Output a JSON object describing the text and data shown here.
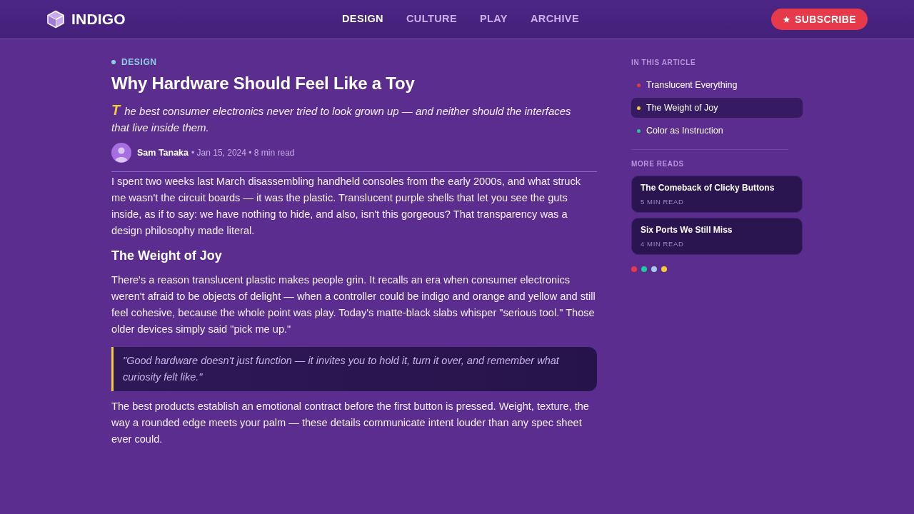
{
  "header": {
    "logo": "INDIGO",
    "nav": [
      {
        "label": "DESIGN",
        "selected": true
      },
      {
        "label": "CULTURE",
        "selected": false
      },
      {
        "label": "PLAY",
        "selected": false
      },
      {
        "label": "ARCHIVE",
        "selected": false
      }
    ],
    "subscribe": "SUBSCRIBE"
  },
  "article": {
    "category": "DESIGN",
    "title": "Why Hardware Should Feel Like a Toy",
    "lede": {
      "drop_cap": "T",
      "text": "he best consumer electronics never tried to look grown up — and neither should the interfaces that live inside them."
    },
    "byline": {
      "author": "Sam Tanaka",
      "meta": "• Jan 15, 2024 • 8 min read"
    },
    "body": [
      {
        "kind": "paragraph",
        "text": "I spent two weeks last March disassembling handheld consoles from the early 2000s, and what struck me wasn't the circuit boards — it was the plastic. Translucent purple shells that let you see the guts inside, as if to say: we have nothing to hide, and also, isn't this gorgeous? That transparency was a design philosophy made literal."
      },
      {
        "kind": "heading",
        "text": "The Weight of Joy"
      },
      {
        "kind": "paragraph",
        "text": "There's a reason translucent plastic makes people grin. It recalls an era when consumer electronics weren't afraid to be objects of delight — when a controller could be indigo and orange and yellow and still feel cohesive, because the whole point was play. Today's matte-black slabs whisper \"serious tool.\" Those older devices simply said \"pick me up.\""
      },
      {
        "kind": "quote",
        "text": "\"Good hardware doesn't just function — it invites you to hold it, turn it over, and remember what curiosity felt like.\""
      },
      {
        "kind": "paragraph",
        "text": "The best products establish an emotional contract before the first button is pressed. Weight, texture, the way a rounded edge meets your palm — these details communicate intent louder than any spec sheet ever could."
      }
    ]
  },
  "sidebar": {
    "toc_title": "IN THIS ARTICLE",
    "toc": [
      {
        "label": "Translucent Everything",
        "color": "#e8394a",
        "selected": false
      },
      {
        "label": "The Weight of Joy",
        "color": "#f5c93a",
        "selected": true
      },
      {
        "label": "Color as Instruction",
        "color": "#1cc9a0",
        "selected": false
      }
    ],
    "more_title": "MORE READS",
    "more_reads": [
      {
        "title": "The Comeback of Clicky Buttons",
        "meta": "5 MIN READ"
      },
      {
        "title": "Six Ports We Still Miss",
        "meta": "4 MIN READ"
      }
    ],
    "palette": [
      {
        "color": "#e8394a"
      },
      {
        "color": "#1cc9a0"
      },
      {
        "color": "#a8c8e8"
      },
      {
        "color": "#f5c93a"
      }
    ]
  }
}
